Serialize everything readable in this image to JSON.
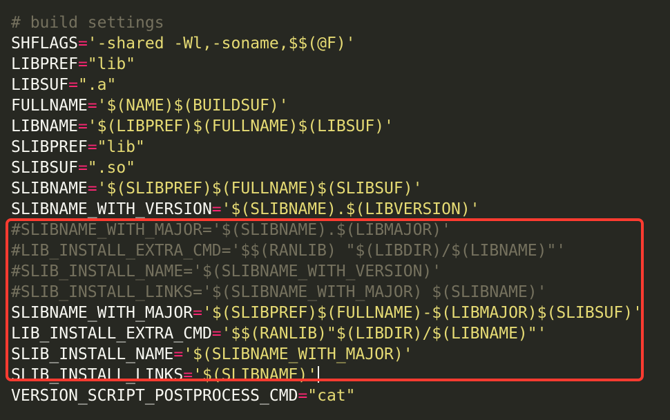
{
  "editor": {
    "accent_colors": {
      "background": "#272822",
      "comment": "#75715e",
      "operator": "#f92672",
      "string": "#e6db74",
      "text": "#f8f8f2",
      "highlight_border": "#ff3b30"
    },
    "lines": [
      {
        "comment": "# build settings"
      },
      {
        "name": "SHFLAGS",
        "op": "=",
        "value": "'-shared -Wl,-soname,$$(@F)'"
      },
      {
        "name": "LIBPREF",
        "op": "=",
        "value": "\"lib\""
      },
      {
        "name": "LIBSUF",
        "op": "=",
        "value": "\".a\""
      },
      {
        "name": "FULLNAME",
        "op": "=",
        "value": "'$(NAME)$(BUILDSUF)'"
      },
      {
        "name": "LIBNAME",
        "op": "=",
        "value": "'$(LIBPREF)$(FULLNAME)$(LIBSUF)'"
      },
      {
        "name": "SLIBPREF",
        "op": "=",
        "value": "\"lib\""
      },
      {
        "name": "SLIBSUF",
        "op": "=",
        "value": "\".so\""
      },
      {
        "name": "SLIBNAME",
        "op": "=",
        "value": "'$(SLIBPREF)$(FULLNAME)$(SLIBSUF)'"
      },
      {
        "name": "SLIBNAME_WITH_VERSION",
        "op": "=",
        "value": "'$(SLIBNAME).$(LIBVERSION)'"
      },
      {
        "comment": "#SLIBNAME_WITH_MAJOR='$(SLIBNAME).$(LIBMAJOR)'"
      },
      {
        "comment": "#LIB_INSTALL_EXTRA_CMD='$$(RANLIB) \"$(LIBDIR)/$(LIBNAME)\"'"
      },
      {
        "comment": "#SLIB_INSTALL_NAME='$(SLIBNAME_WITH_VERSION)'"
      },
      {
        "comment": "#SLIB_INSTALL_LINKS='$(SLIBNAME_WITH_MAJOR) $(SLIBNAME)'"
      },
      {
        "name": "SLIBNAME_WITH_MAJOR",
        "op": "=",
        "value": "'$(SLIBPREF)$(FULLNAME)-$(LIBMAJOR)$(SLIBSUF)'"
      },
      {
        "name": "LIB_INSTALL_EXTRA_CMD",
        "op": "=",
        "value": "'$$(RANLIB)\"$(LIBDIR)/$(LIBNAME)\"'"
      },
      {
        "name": "SLIB_INSTALL_NAME",
        "op": "=",
        "value": "'$(SLIBNAME_WITH_MAJOR)'"
      },
      {
        "name": "SLIB_INSTALL_LINKS",
        "op": "=",
        "value": "'$(SLIBNAME)'",
        "cursor": true
      },
      {
        "name": "VERSION_SCRIPT_POSTPROCESS_CMD",
        "op": "=",
        "value": "\"cat\""
      }
    ]
  }
}
